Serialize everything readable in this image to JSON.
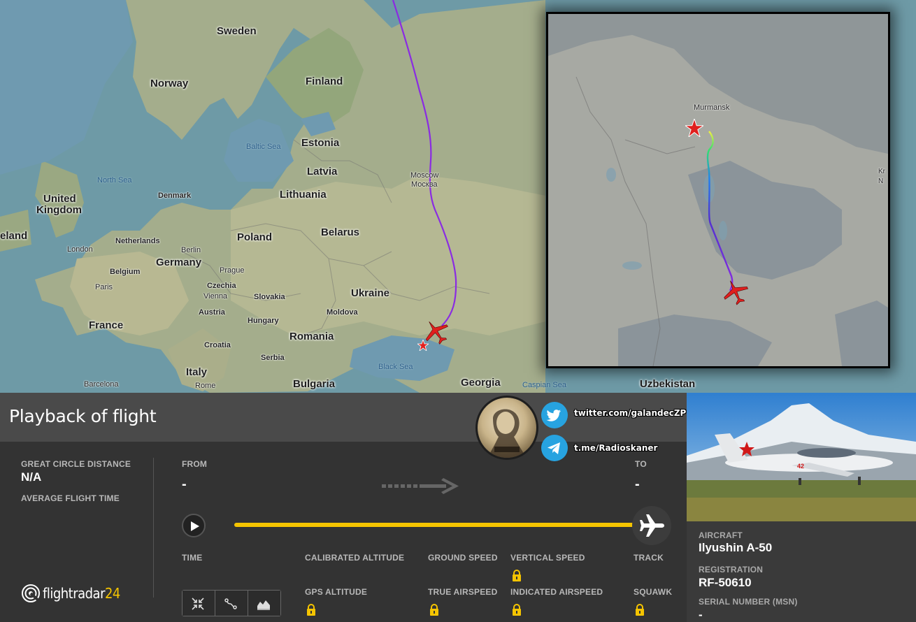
{
  "map": {
    "countries": [
      {
        "name": "Sweden"
      },
      {
        "name": "Finland"
      },
      {
        "name": "Norway"
      },
      {
        "name": "Estonia"
      },
      {
        "name": "Latvia"
      },
      {
        "name": "Lithuania"
      },
      {
        "name": "Denmark"
      },
      {
        "name": "United"
      },
      {
        "name": "Kingdom"
      },
      {
        "name": "eland"
      },
      {
        "name": "Netherlands"
      },
      {
        "name": "Belgium"
      },
      {
        "name": "Germany"
      },
      {
        "name": "Poland"
      },
      {
        "name": "Belarus"
      },
      {
        "name": "Czechia"
      },
      {
        "name": "Slovakia"
      },
      {
        "name": "Austria"
      },
      {
        "name": "Hungary"
      },
      {
        "name": "Ukraine"
      },
      {
        "name": "Moldova"
      },
      {
        "name": "Romania"
      },
      {
        "name": "France"
      },
      {
        "name": "Croatia"
      },
      {
        "name": "Serbia"
      },
      {
        "name": "Italy"
      },
      {
        "name": "Bulgaria"
      },
      {
        "name": "Georgia"
      },
      {
        "name": "Uzbekistan"
      }
    ],
    "cities": [
      "London",
      "Berlin",
      "Prague",
      "Vienna",
      "Paris",
      "Barcelona",
      "Rome",
      "Moscow",
      "Москва"
    ],
    "seas": [
      "Baltic Sea",
      "North Sea",
      "Black Sea",
      "Caspian Sea"
    ],
    "inset_labels": [
      "Murmansk",
      "Kr",
      "N"
    ]
  },
  "panel": {
    "title": "Playback of flight",
    "great_circle_label": "GREAT CIRCLE DISTANCE",
    "great_circle_value": "N/A",
    "avg_flight_label": "AVERAGE FLIGHT TIME",
    "from_label": "FROM",
    "from_value": "-",
    "to_label": "TO",
    "to_value": "-",
    "time_label": "TIME",
    "calibrated_alt_label": "CALIBRATED ALTITUDE",
    "ground_speed_label": "GROUND SPEED",
    "vertical_speed_label": "VERTICAL SPEED",
    "track_label": "TRACK",
    "gps_alt_label": "GPS ALTITUDE",
    "true_airspeed_label": "TRUE AIRSPEED",
    "indicated_airspeed_label": "INDICATED AIRSPEED",
    "squawk_label": "SQUAWK",
    "logo_text": "flightradar",
    "logo_num": "24",
    "playback_progress": 1.0
  },
  "social": {
    "twitter": "twitter.com/galandecZP",
    "telegram": "t.me/Radioskaner"
  },
  "sidebar": {
    "aircraft_label": "AIRCRAFT",
    "aircraft_value": "Ilyushin A-50",
    "registration_label": "REGISTRATION",
    "registration_value": "RF-50610",
    "serial_label": "SERIAL NUMBER (MSN)",
    "serial_value": "-",
    "photo_tail_number": "42"
  },
  "colors": {
    "accent": "#f5c400",
    "flight_path": "#8a2be2",
    "aircraft_icon": "#e0201e",
    "panel_bg": "#333333",
    "header_bg": "#4a4a4a"
  }
}
